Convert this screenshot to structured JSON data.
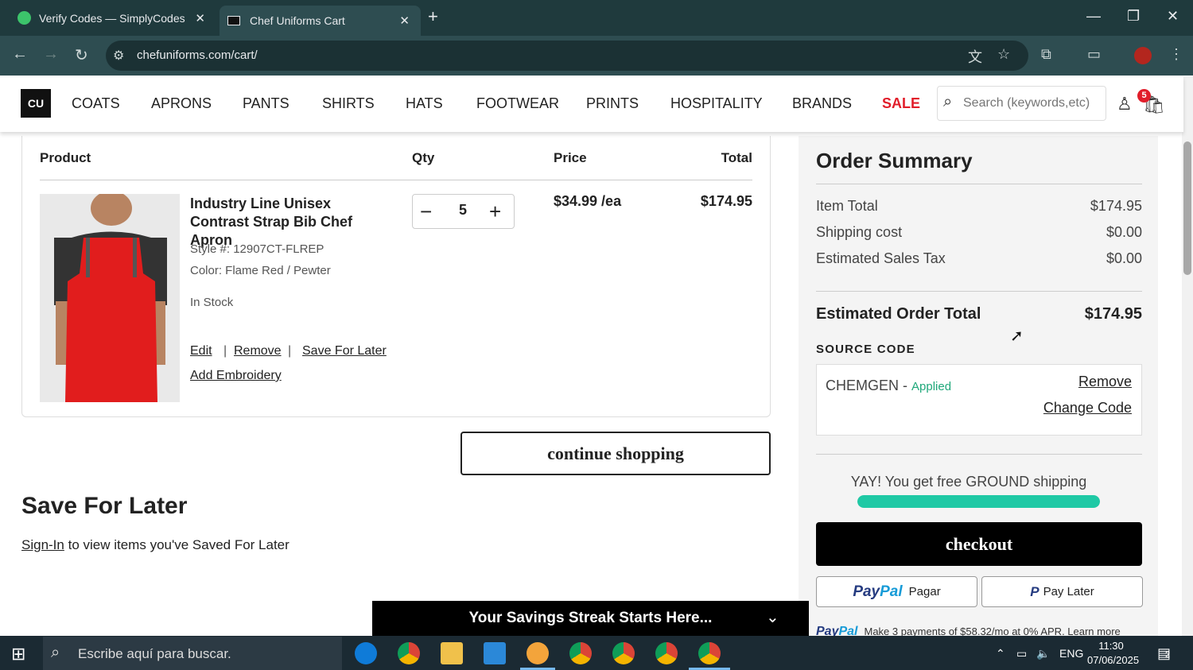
{
  "browser": {
    "tabs": [
      {
        "label": "Verify Codes — SimplyCodes",
        "active": false
      },
      {
        "label": "Chef Uniforms Cart",
        "active": true
      }
    ],
    "url": "chefuniforms.com/cart/"
  },
  "site": {
    "logo": "CU",
    "nav": [
      "COATS",
      "APRONS",
      "PANTS",
      "SHIRTS",
      "HATS",
      "FOOTWEAR",
      "PRINTS",
      "HOSPITALITY",
      "BRANDS",
      "SALE"
    ],
    "search_placeholder": "Search (keywords,etc)",
    "cart_count": "5",
    "sale_color": "#e11d2a"
  },
  "cart": {
    "headers": {
      "product": "Product",
      "qty": "Qty",
      "price": "Price",
      "total": "Total"
    },
    "item": {
      "name": "Industry Line Unisex Contrast Strap Bib Chef Apron",
      "style": "Style #: 12907CT-FLREP",
      "color": "Color:  Flame Red / Pewter",
      "stock": "In Stock",
      "qty": "5",
      "price": "$34.99 /ea",
      "total": "$174.95",
      "actions": {
        "edit": "Edit",
        "remove": "Remove",
        "save": "Save For Later",
        "embroidery": "Add Embroidery"
      },
      "sep": "|"
    },
    "continue": "continue shopping"
  },
  "save_for_later": {
    "title": "Save For Later",
    "signin": "Sign-In",
    "text": " to view items you've Saved For Later"
  },
  "summary": {
    "title": "Order Summary",
    "item_total_label": "Item Total",
    "item_total": "$174.95",
    "shipping_label": "Shipping cost",
    "shipping": "$0.00",
    "tax_label": "Estimated Sales Tax",
    "tax": "$0.00",
    "order_total_label": "Estimated Order Total",
    "order_total": "$174.95",
    "source_label": "SOURCE CODE",
    "code": "CHEMGEN - ",
    "applied": "Applied",
    "remove": "Remove",
    "change": "Change Code",
    "shipping_msg": "YAY! You get free GROUND shipping",
    "shipping_progress": 1.0,
    "checkout": "checkout",
    "paypal_pay": "Pagar",
    "paypal_later": "Pay Later",
    "paypal_msg": "Make 3 payments of $58.32/mo at 0% APR. Learn more",
    "accent_color": "#1fc9a5"
  },
  "banner": {
    "text": "Your Savings Streak Starts Here..."
  },
  "taskbar": {
    "search": "Escribe aquí para buscar.",
    "lang": "ENG",
    "time": "11:30",
    "date": "07/06/2025",
    "notif": "2"
  }
}
